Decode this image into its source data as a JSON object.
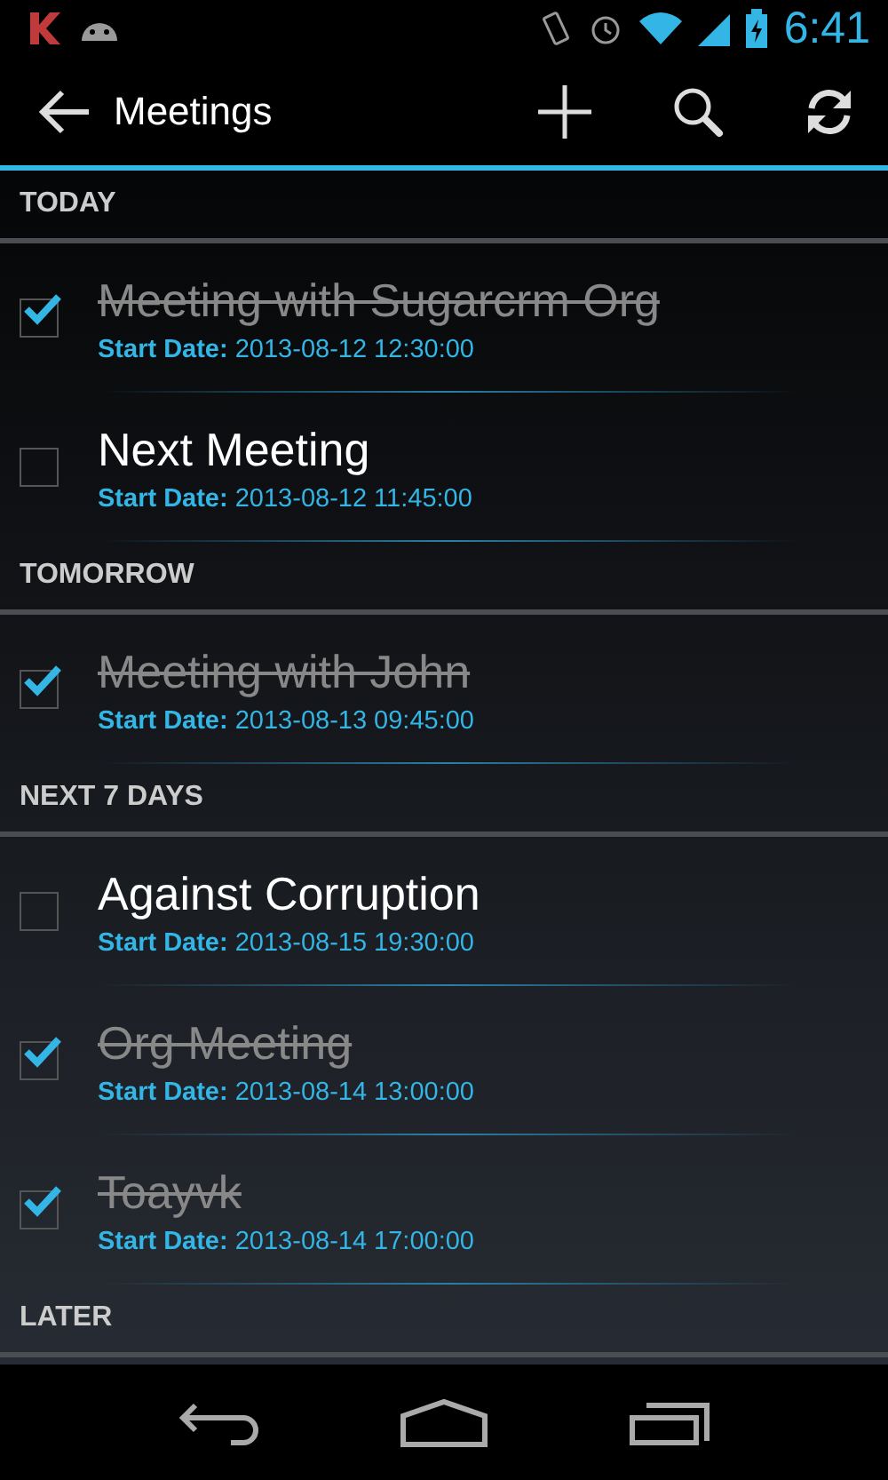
{
  "status_bar": {
    "time": "6:41"
  },
  "action_bar": {
    "title": "Meetings"
  },
  "sections": [
    {
      "title": "TODAY",
      "items": [
        {
          "title": "Meeting with Sugarcrm Org",
          "date": "**Start Date:** 2013-08-12 12:30:00",
          "checked": true
        },
        {
          "title": "Next Meeting",
          "date": "**Start Date:** 2013-08-12 11:45:00",
          "checked": false
        }
      ]
    },
    {
      "title": "TOMORROW",
      "items": [
        {
          "title": "Meeting with John",
          "date": "**Start Date:** 2013-08-13 09:45:00",
          "checked": true
        }
      ]
    },
    {
      "title": "NEXT 7 DAYS",
      "items": [
        {
          "title": "Against Corruption",
          "date": "**Start Date:** 2013-08-15 19:30:00",
          "checked": false
        },
        {
          "title": "Org Meeting",
          "date": "**Start Date:** 2013-08-14 13:00:00",
          "checked": true
        },
        {
          "title": "Toayvk",
          "date": "**Start Date:** 2013-08-14 17:00:00",
          "checked": true
        }
      ]
    },
    {
      "title": "LATER"
    }
  ]
}
